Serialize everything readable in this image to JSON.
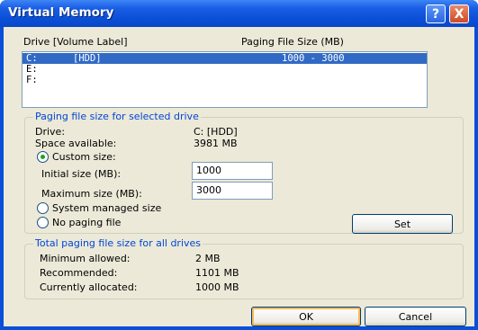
{
  "window": {
    "title": "Virtual Memory"
  },
  "titlebar": {
    "help_label": "?",
    "close_label": "X"
  },
  "drive_list": {
    "header_drive": "Drive  [Volume Label]",
    "header_size": "Paging File Size (MB)",
    "rows": [
      {
        "drive": "C:",
        "label": "[HDD]",
        "size": "1000 - 3000"
      },
      {
        "drive": "E:",
        "label": "",
        "size": ""
      },
      {
        "drive": "F:",
        "label": "",
        "size": ""
      }
    ]
  },
  "selected_drive_group": {
    "legend": "Paging file size for selected drive",
    "drive_label": "Drive:",
    "drive_value": "C:  [HDD]",
    "space_label": "Space available:",
    "space_value": "3981 MB",
    "custom_size_label": "Custom size:",
    "initial_label": "Initial size (MB):",
    "initial_value": "1000",
    "maximum_label": "Maximum size (MB):",
    "maximum_value": "3000",
    "system_managed_label": "System managed size",
    "no_paging_label": "No paging file",
    "set_label": "Set",
    "selected_option": "custom"
  },
  "total_group": {
    "legend": "Total paging file size for all drives",
    "minimum_label": "Minimum allowed:",
    "minimum_value": "2 MB",
    "recommended_label": "Recommended:",
    "recommended_value": "1101 MB",
    "allocated_label": "Currently allocated:",
    "allocated_value": "1000 MB"
  },
  "footer": {
    "ok_label": "OK",
    "cancel_label": "Cancel"
  },
  "colors": {
    "titlebar": "#0a4fd8",
    "dialog_bg": "#ece9d8",
    "selection": "#316ac5",
    "legend_text": "#0046d5"
  }
}
